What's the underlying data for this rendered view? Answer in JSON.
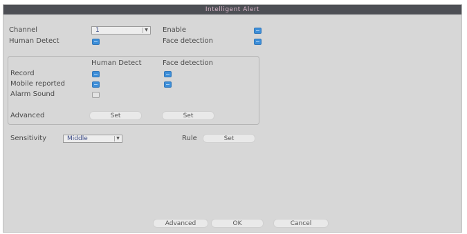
{
  "window": {
    "title": "Intelligent Alert"
  },
  "top": {
    "channel_label": "Channel",
    "channel_value": "1",
    "human_detect_label": "Human Detect",
    "enable_label": "Enable",
    "face_detection_label": "Face detection"
  },
  "group": {
    "col_human_detect": "Human Detect",
    "col_face_detection": "Face detection",
    "record_label": "Record",
    "mobile_reported_label": "Mobile reported",
    "alarm_sound_label": "Alarm Sound",
    "advanced_label": "Advanced",
    "set_human_label": "Set",
    "set_face_label": "Set"
  },
  "sensitivity": {
    "label": "Sensitivity",
    "value": "Middle",
    "rule_label": "Rule",
    "rule_set_label": "Set"
  },
  "footer": {
    "advanced_label": "Advanced",
    "ok_label": "OK",
    "cancel_label": "Cancel"
  },
  "colors": {
    "titlebar": "#4d4f55",
    "title_text": "#d8b6c9",
    "panel_bg": "#d7d7d7",
    "checkbox_checked": "#3d8ed8"
  }
}
